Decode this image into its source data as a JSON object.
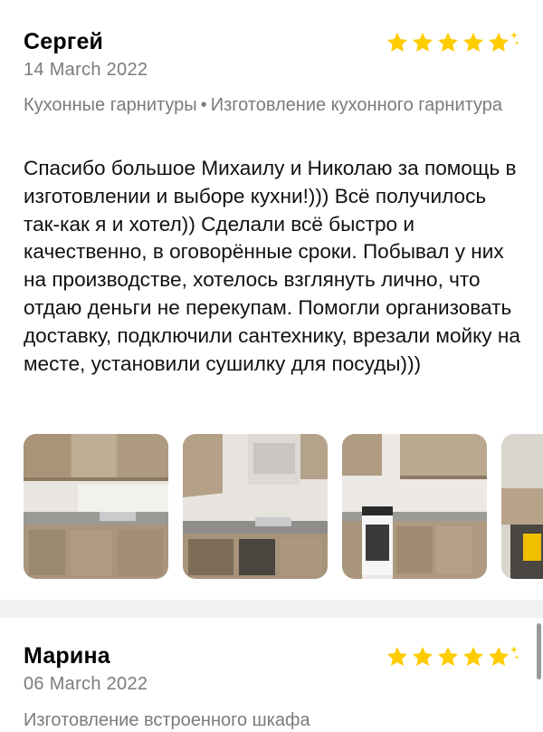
{
  "reviews": [
    {
      "author": "Сергей",
      "date": "14 March 2022",
      "rating": 5,
      "category": "Кухонные гарнитуры",
      "service": "Изготовление кухонного гарнитура",
      "text": "Спасибо большое Михаилу и Николаю за помощь в изготовлении и выборе кухни!))) Всё получилось так-как я и хотел)) Сделали всё быстро и качественно, в оговорённые сроки. Побывал у них на производстве, хотелось взглянуть лично, что отдаю деньги не перекупам. Помогли организовать доставку, подключили сантехнику, врезали мойку на месте, установили сушилку для посуды)))",
      "photos": [
        "kitchen-photo-1",
        "kitchen-photo-2",
        "kitchen-photo-3",
        "kitchen-photo-4"
      ]
    },
    {
      "author": "Марина",
      "date": "06 March 2022",
      "rating": 5,
      "category": "Изготовление встроенного шкафа"
    }
  ],
  "colors": {
    "star": "#FFCC00",
    "secondary_text": "#7B7B80",
    "divider": "#F1F1F3"
  },
  "separator": "•"
}
